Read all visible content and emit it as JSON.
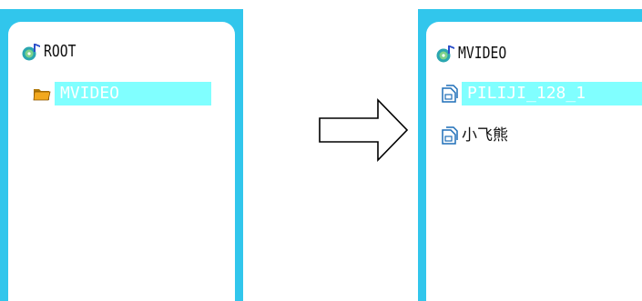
{
  "left_panel": {
    "root_label": "ROOT",
    "folder_label": "MVIDEO"
  },
  "right_panel": {
    "header_label": "MVIDEO",
    "items": [
      {
        "label": "PILIJI_128_1"
      },
      {
        "label": "小飞熊"
      }
    ]
  },
  "colors": {
    "frame": "#31c6ec",
    "selection": "#80ffff"
  },
  "icons": {
    "root": "music-disc-icon",
    "folder": "folder-icon",
    "file": "video-file-icon",
    "arrow": "right-arrow-icon"
  }
}
